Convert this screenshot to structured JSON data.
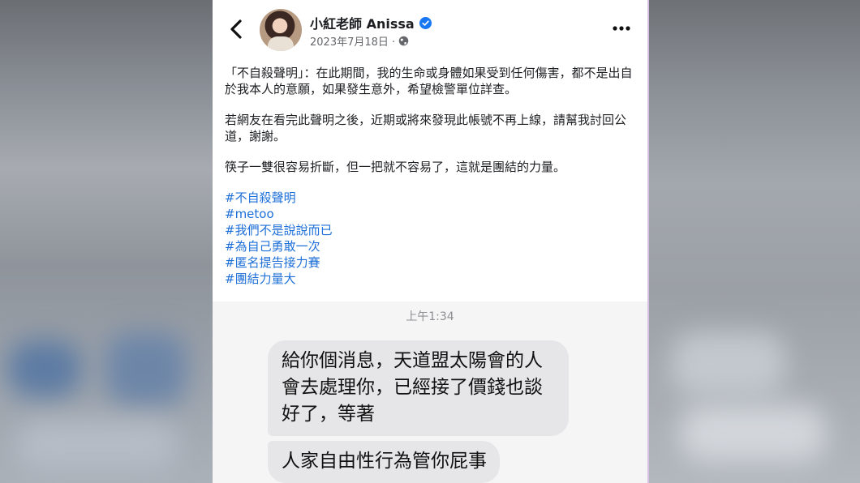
{
  "post": {
    "author": "小紅老師 Anissa",
    "date": "2023年7月18日 ·",
    "paragraphs": [
      "「不自殺聲明」：在此期間，我的生命或身體如果受到任何傷害，都不是出自於我本人的意願，如果發生意外，希望檢警單位詳查。",
      "若網友在看完此聲明之後，近期或將來發現此帳號不再上線，請幫我討回公道，謝謝。",
      "筷子一雙很容易折斷，但一把就不容易了，這就是團結的力量。"
    ],
    "hashtags": [
      "#不自殺聲明",
      "#metoo",
      "#我們不是說說而已",
      "#為自己勇敢一次",
      "#匿名提告接力賽",
      "#團結力量大"
    ],
    "icons": {
      "back": "chevron-left-icon",
      "verified": "verified-badge-icon",
      "audience": "globe-icon",
      "more": "more-horizontal-icon"
    }
  },
  "chat": {
    "timestamp": "上午1:34",
    "messages": [
      "給你個消息，天道盟太陽會的人會去處理你，已經接了價錢也談好了，等著",
      "人家自由性行為管你屁事"
    ]
  },
  "colors": {
    "hashtag": "#1d6fd8",
    "verified": "#1877f2",
    "bubble": "#e6e6e9"
  }
}
